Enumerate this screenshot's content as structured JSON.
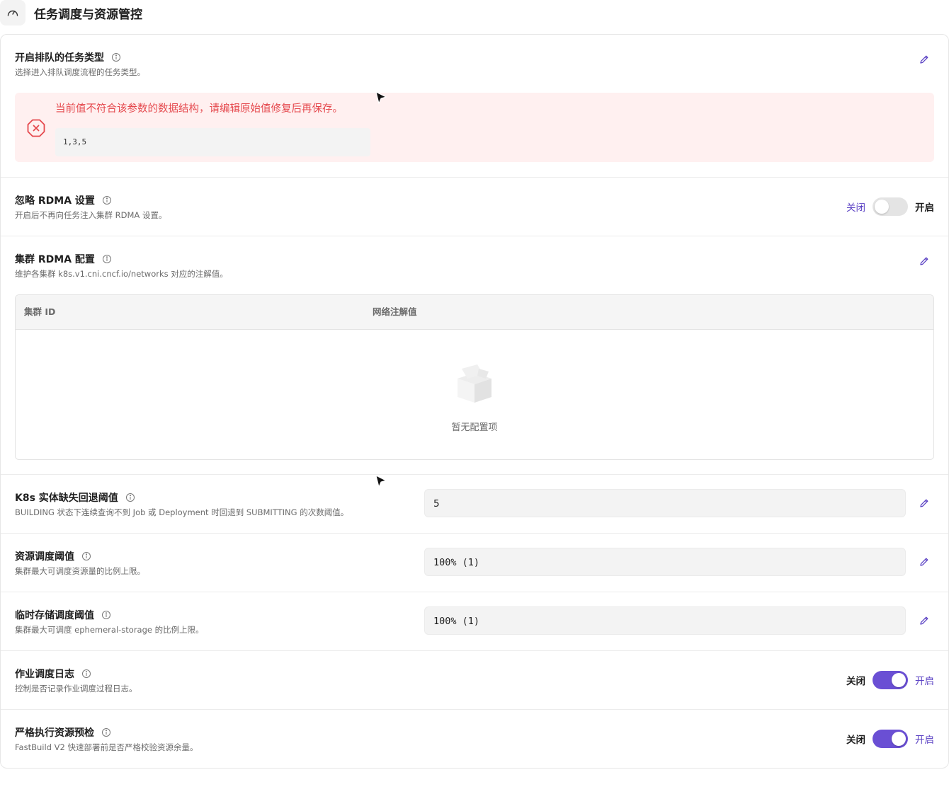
{
  "header": {
    "icon": "gauge-icon",
    "title": "任务调度与资源管控"
  },
  "queue_types": {
    "title": "开启排队的任务类型",
    "description": "选择进入排队调度流程的任务类型。",
    "error_message": "当前值不符合该参数的数据结构，请编辑原始值修复后再保存。",
    "raw_value": "1,3,5"
  },
  "ignore_rdma": {
    "title": "忽略 RDMA 设置",
    "description": "开启后不再向任务注入集群 RDMA 设置。",
    "off_label": "关闭",
    "on_label": "开启",
    "enabled": false
  },
  "cluster_rdma": {
    "title": "集群 RDMA 配置",
    "description": "维护各集群 k8s.v1.cni.cncf.io/networks 对应的注解值。",
    "columns": [
      "集群 ID",
      "网络注解值"
    ],
    "empty_text": "暂无配置项"
  },
  "k8s_fallback": {
    "title": "K8s 实体缺失回退阈值",
    "description": "BUILDING 状态下连续查询不到 Job 或 Deployment 时回退到 SUBMITTING 的次数阈值。",
    "value": "5"
  },
  "resource_threshold": {
    "title": "资源调度阈值",
    "description": "集群最大可调度资源量的比例上限。",
    "value": "100% (1)"
  },
  "ephemeral_threshold": {
    "title": "临时存储调度阈值",
    "description": "集群最大可调度 ephemeral-storage 的比例上限。",
    "value": "100% (1)"
  },
  "job_log": {
    "title": "作业调度日志",
    "description": "控制是否记录作业调度过程日志。",
    "off_label": "关闭",
    "on_label": "开启",
    "enabled": true
  },
  "strict_precheck": {
    "title": "严格执行资源预检",
    "description": "FastBuild V2 快速部署前是否严格校验资源余量。",
    "off_label": "关闭",
    "on_label": "开启",
    "enabled": true
  },
  "colors": {
    "accent": "#6a4fd4",
    "error": "#e5484d",
    "error_bg": "#fff0f0"
  }
}
